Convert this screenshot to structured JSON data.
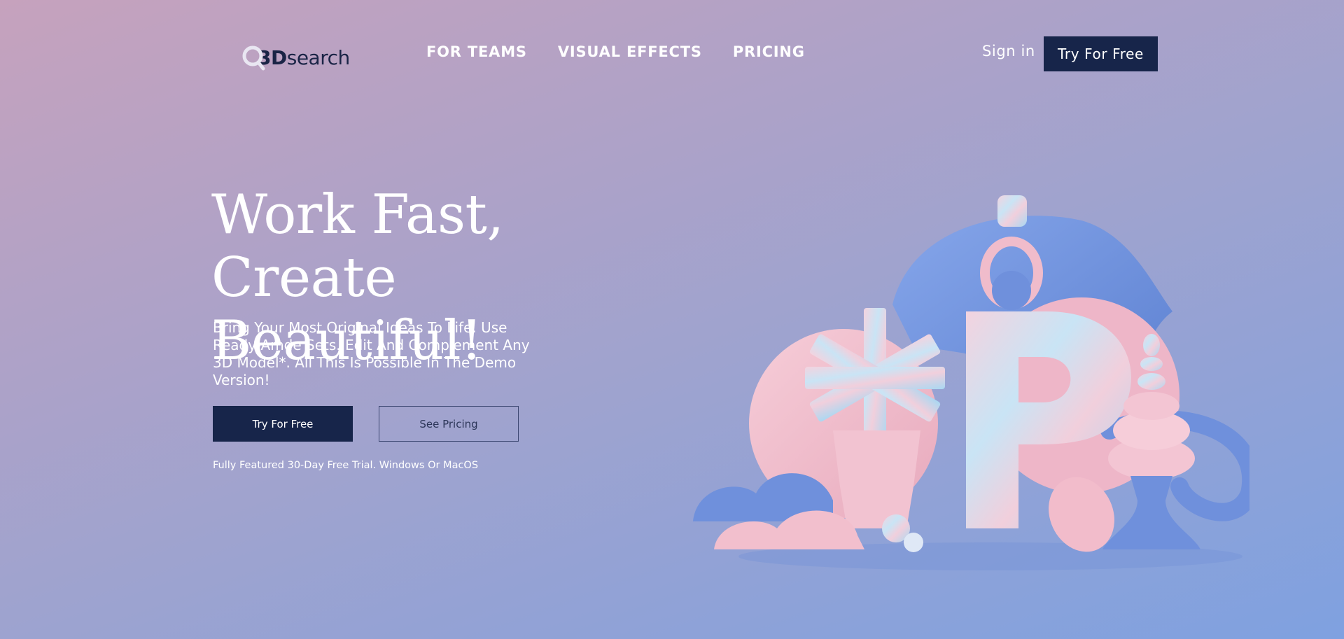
{
  "header": {
    "logo": {
      "prefix": "3D",
      "suffix": "search"
    },
    "nav": [
      {
        "label": "FOR TEAMS"
      },
      {
        "label": "VISUAL EFFECTS"
      },
      {
        "label": "PRICING"
      }
    ],
    "sign_in": "Sign in",
    "cta": "Try For Free"
  },
  "hero": {
    "title_line1": "Work Fast, Create",
    "title_line2": "Beautiful!",
    "subtitle": "Bring Your Most Original Ideas To Life. Use Ready-Amde Sets. Edit And Complement Any 3D Model*. All This Is Possible In The Demo Version!",
    "primary_button": "Try For Free",
    "secondary_button": "See Pricing",
    "note": "Fully Featured 30-Day Free Trial. Windows Or MacOS"
  },
  "illustration": {
    "letter": "P",
    "colors": {
      "pink": "#f0bccb",
      "blue": "#6f90dc",
      "accent": "#4fb6ea",
      "navy": "#17254a"
    }
  }
}
